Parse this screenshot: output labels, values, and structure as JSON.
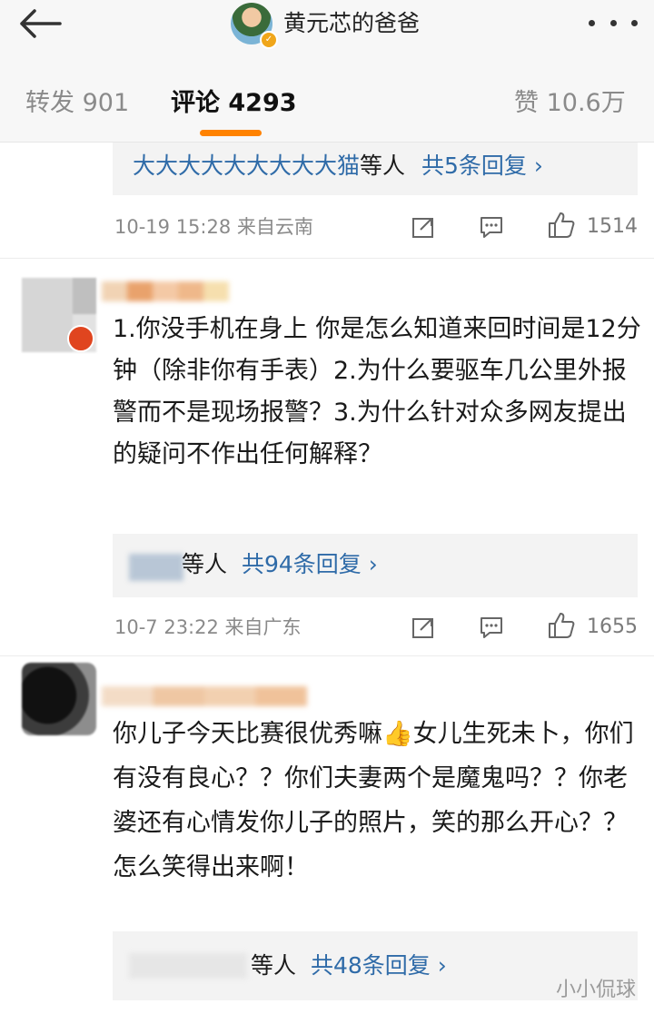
{
  "header": {
    "title": "黄元芯的爸爸",
    "back_icon": "arrow-left-icon",
    "more_icon": "more-dots-icon",
    "badge": "✓"
  },
  "tabs": {
    "repost": "转发 901",
    "comments": "评论 4293",
    "likes": "赞 10.6万",
    "accent": "#ff8200"
  },
  "comments": [
    {
      "reply_names": "大大大大大大大大大猫",
      "reply_suffix": "等人",
      "reply_link": "共5条回复 ›",
      "time": "10-19 15:28 来自云南",
      "likes": "1514"
    },
    {
      "text": "1.你没手机在身上 你是怎么知道来回时间是12分钟（除非你有手表）2.为什么要驱车几公里外报警而不是现场报警？3.为什么针对众多网友提出的疑问不作出任何解释？",
      "reply_names": "",
      "reply_suffix": "等人",
      "reply_link": "共94条回复 ›",
      "time": "10-7 23:22 来自广东",
      "likes": "1655"
    },
    {
      "text": "你儿子今天比赛很优秀嘛👍女儿生死未卜，你们有没有良心？？你们夫妻两个是魔鬼吗？？你老婆还有心情发你儿子的照片，笑的那么开心？？怎么笑得出来啊！",
      "reply_suffix": "等人",
      "reply_link": "共48条回复 ›"
    }
  ],
  "watermark": "小小侃球",
  "colors": {
    "link": "#2f6ba8",
    "meta": "#8a8a8a",
    "reply_bg": "#f3f3f3"
  }
}
